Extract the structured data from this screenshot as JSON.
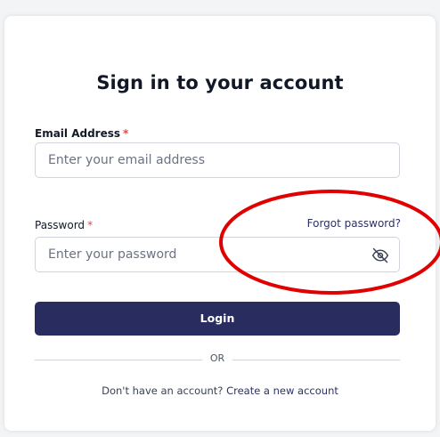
{
  "form": {
    "title": "Sign in to your account",
    "email_label": "Email Address",
    "email_required": "*",
    "email_placeholder": "Enter your email address",
    "password_label": "Password",
    "password_required": "*",
    "password_placeholder": "Enter your password",
    "forgot_password": "Forgot password?",
    "login_button": "Login",
    "divider_text": "OR",
    "signup_prompt": "Don't have an account?",
    "signup_link": "Create a new account"
  },
  "icons": {
    "password_toggle": "eye-off-icon"
  },
  "colors": {
    "primary": "#292c5e",
    "required": "#ef4444",
    "annotation": "#e00000"
  }
}
